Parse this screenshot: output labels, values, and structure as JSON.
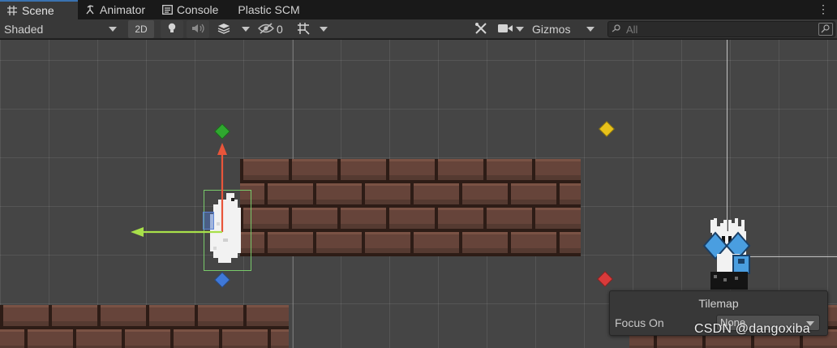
{
  "tabs": [
    {
      "label": "Scene",
      "icon": "grid-icon",
      "active": true
    },
    {
      "label": "Animator",
      "icon": "animator-icon",
      "active": false
    },
    {
      "label": "Console",
      "icon": "console-icon",
      "active": false
    },
    {
      "label": "Plastic SCM",
      "icon": "",
      "active": false
    }
  ],
  "tab_menu_icon": "kebab-menu-icon",
  "toolbar": {
    "draw_mode": "Shaded",
    "mode_2d": "2D",
    "hidden_count": "0",
    "gizmos_label": "Gizmos",
    "search_placeholder": "All"
  },
  "tilemap_overlay": {
    "title": "Tilemap",
    "focus_label": "Focus On",
    "focus_value": "None"
  },
  "watermark": "CSDN @dangoxiba",
  "colors": {
    "tab_accent": "#3a72b0",
    "gizmo_x": "#a8e04a",
    "gizmo_y": "#e8553a",
    "selection": "#79c96a",
    "diamond_green": "#2fa82f",
    "diamond_blue": "#3f78d8",
    "diamond_yellow": "#e8c21a",
    "diamond_red": "#d83a3a",
    "character_blue": "#4a9ee0"
  }
}
